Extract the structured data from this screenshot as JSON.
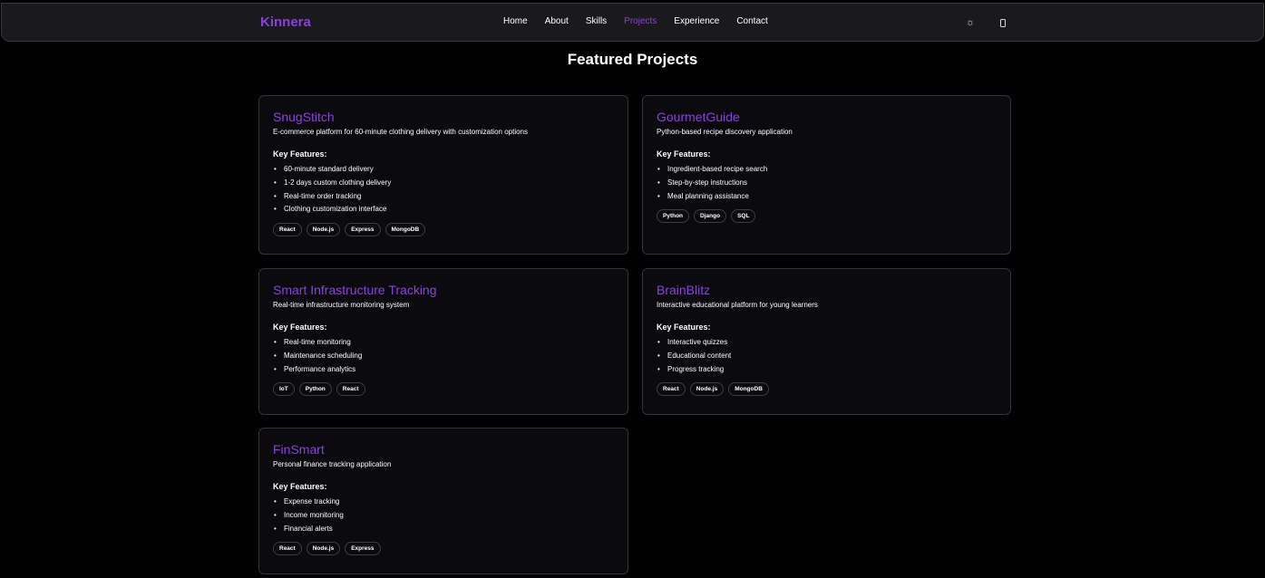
{
  "nav": {
    "brand": "Kinnera",
    "links": [
      "Home",
      "About",
      "Skills",
      "Projects",
      "Experience",
      "Contact"
    ],
    "active_link": "Projects",
    "icons": [
      "sun-icon",
      "mobile-icon"
    ],
    "accent_color": "#8b3fe0"
  },
  "main": {
    "title": "Featured Projects",
    "features_heading": "Key Features:",
    "projects": [
      {
        "title": "SnugStitch",
        "description": "E-commerce platform for 60-minute clothing delivery with customization options",
        "features": [
          "60-minute standard delivery",
          "1-2 days custom clothing delivery",
          "Real-time order tracking",
          "Clothing customization interface"
        ],
        "tags": [
          "React",
          "Node.js",
          "Express",
          "MongoDB"
        ]
      },
      {
        "title": "GourmetGuide",
        "description": "Python-based recipe discovery application",
        "features": [
          "Ingredient-based recipe search",
          "Step-by-step instructions",
          "Meal planning assistance"
        ],
        "tags": [
          "Python",
          "Django",
          "SQL"
        ]
      },
      {
        "title": "Smart Infrastructure Tracking",
        "description": "Real-time infrastructure monitoring system",
        "features": [
          "Real-time monitoring",
          "Maintenance scheduling",
          "Performance analytics"
        ],
        "tags": [
          "IoT",
          "Python",
          "React"
        ]
      },
      {
        "title": "BrainBlitz",
        "description": "Interactive educational platform for young learners",
        "features": [
          "Interactive quizzes",
          "Educational content",
          "Progress tracking"
        ],
        "tags": [
          "React",
          "Node.js",
          "MongoDB"
        ]
      },
      {
        "title": "FinSmart",
        "description": "Personal finance tracking application",
        "features": [
          "Expense tracking",
          "Income monitoring",
          "Financial alerts"
        ],
        "tags": [
          "React",
          "Node.js",
          "Express"
        ]
      }
    ]
  }
}
